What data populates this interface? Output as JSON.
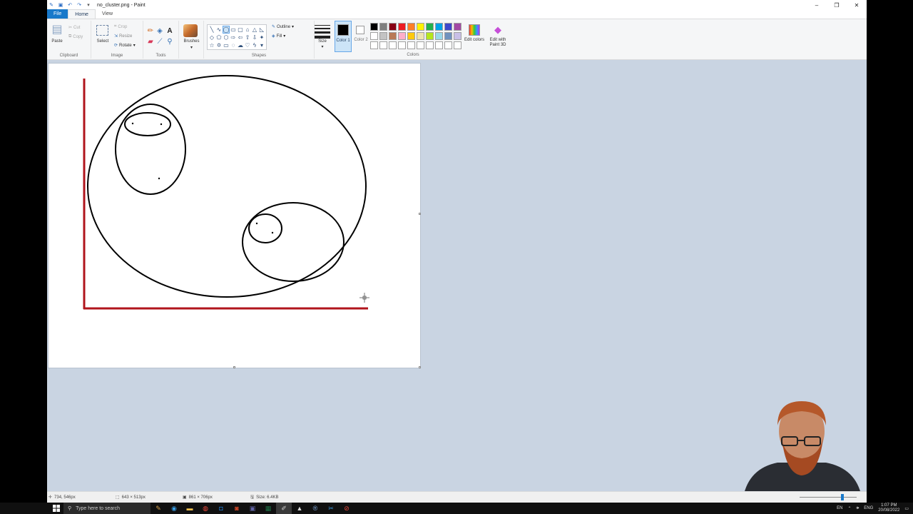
{
  "window": {
    "title": "no_cluster.png - Paint",
    "controls": [
      "minimize-icon",
      "restore-icon",
      "close-icon"
    ]
  },
  "menu": {
    "tabs": [
      "File",
      "Home",
      "View"
    ]
  },
  "ribbon": {
    "clipboard": {
      "paste": "Paste",
      "cut": "Cut",
      "copy": "Copy",
      "label": "Clipboard"
    },
    "image": {
      "select": "Select",
      "crop": "Crop",
      "resize": "Resize",
      "rotate": "Rotate",
      "label": "Image"
    },
    "tools": {
      "label": "Tools"
    },
    "brushes": {
      "label": "Brushes"
    },
    "shapes": {
      "outline": "Outline",
      "fill": "Fill",
      "label": "Shapes"
    },
    "size": {
      "label": "Size"
    },
    "color1": {
      "label": "Color 1",
      "value": "#000000"
    },
    "color2": {
      "label": "Color 2",
      "value": "#ffffff"
    },
    "colors": {
      "label": "Colors",
      "palette": [
        "#000000",
        "#7f7f7f",
        "#880015",
        "#ed1c24",
        "#ff7f27",
        "#fff200",
        "#22b14c",
        "#00a2e8",
        "#3f48cc",
        "#a349a4",
        "#ffffff",
        "#c3c3c3",
        "#b97a57",
        "#ffaec9",
        "#ffc90e",
        "#efe4b0",
        "#b5e61d",
        "#99d9ea",
        "#7092be",
        "#c8bfe7",
        "#ffffff",
        "#ffffff",
        "#ffffff",
        "#ffffff",
        "#ffffff",
        "#ffffff",
        "#ffffff",
        "#ffffff",
        "#ffffff",
        "#ffffff"
      ]
    },
    "edit_colors": "Edit colors",
    "edit_paint3d": "Edit with Paint 3D"
  },
  "status": {
    "cursor_pos": "734, 546px",
    "selection_size": "643 × 513px",
    "canvas_size": "861 × 706px",
    "file_size": "Size: 6.4KB"
  },
  "taskbar": {
    "search_placeholder": "Type here to search",
    "lang1": "EN",
    "lang2": "ENG",
    "time": "1:07 PM",
    "date": "20/08/2022"
  },
  "canvas_drawing": {
    "axis_color": "#b0141c",
    "stroke_color": "#000000"
  }
}
